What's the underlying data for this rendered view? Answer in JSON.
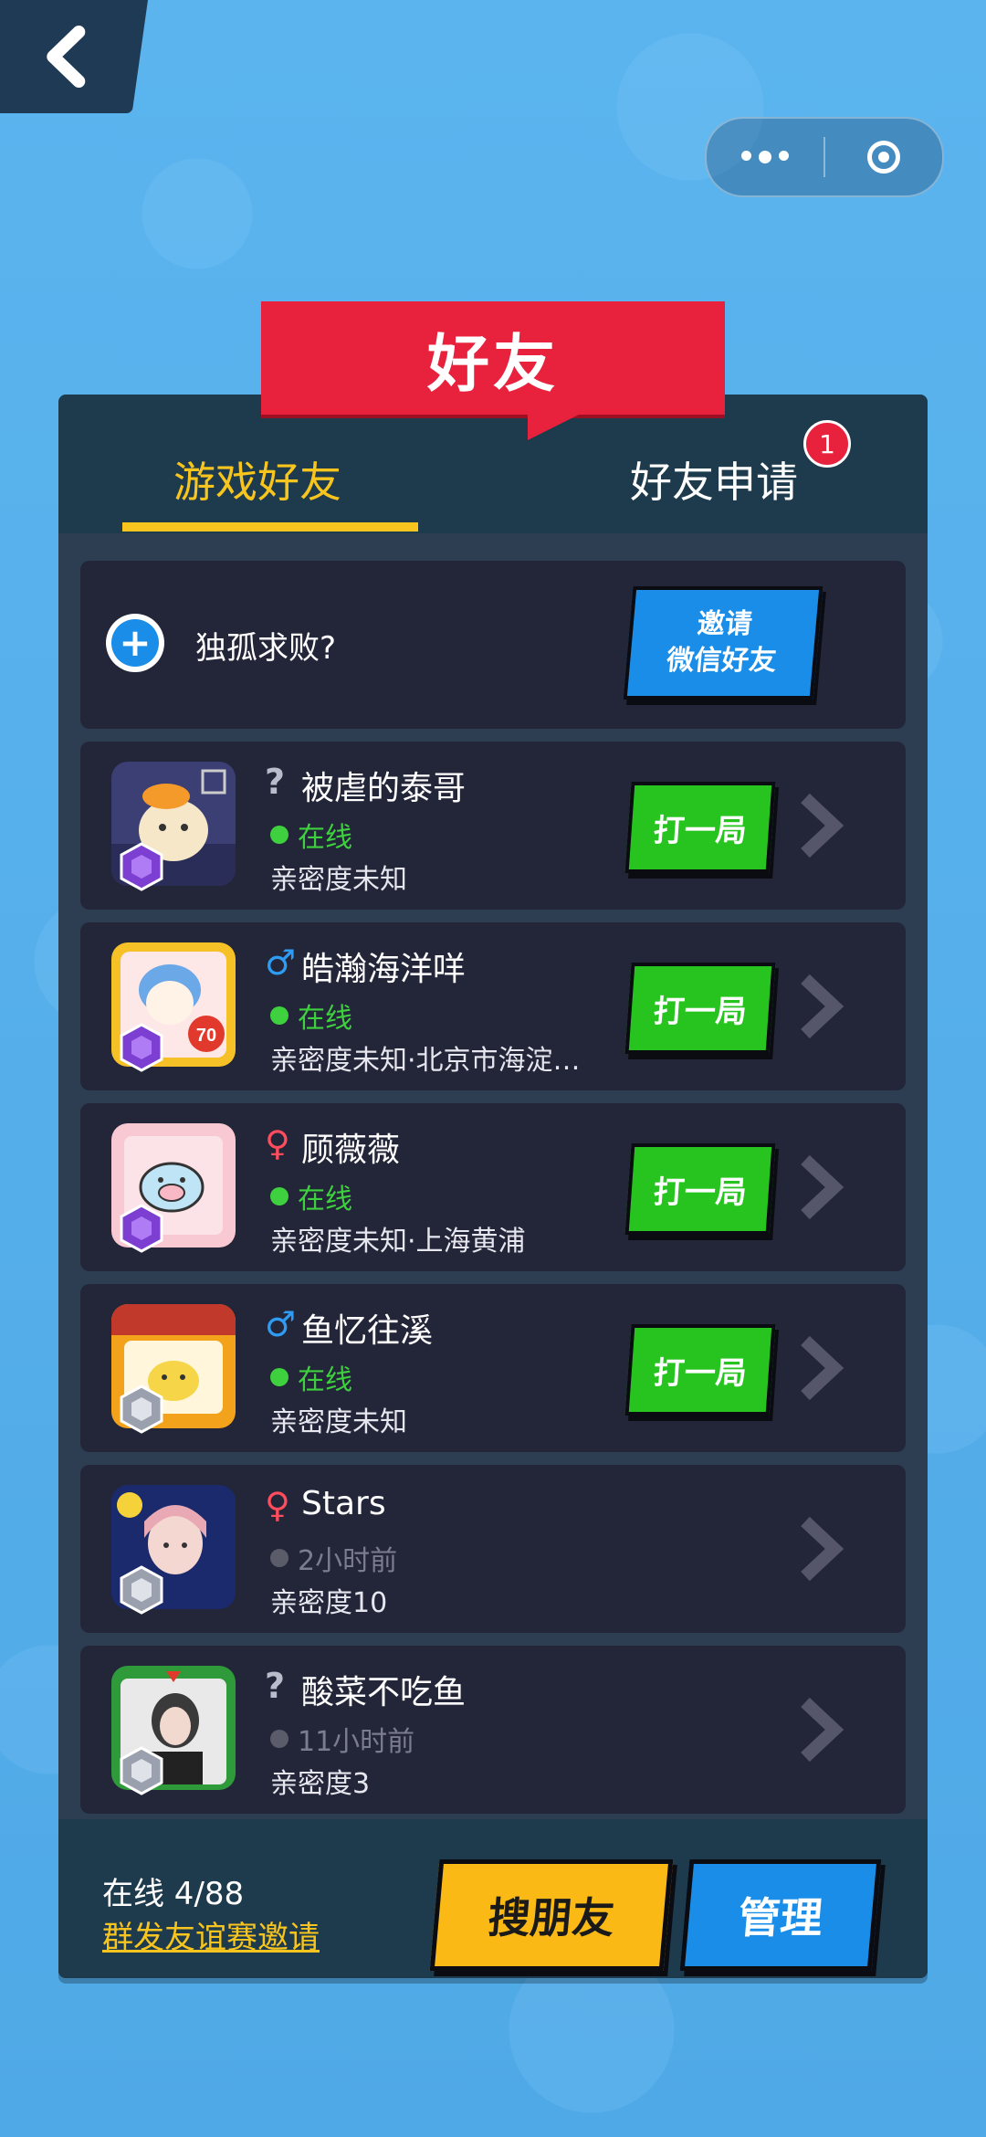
{
  "header": {
    "title": "好友"
  },
  "tabs": [
    {
      "label": "游戏好友",
      "active": true
    },
    {
      "label": "好友申请",
      "active": false,
      "badge": "1"
    }
  ],
  "invite": {
    "plus_icon": "+",
    "text": "独孤求败?",
    "button_line1": "邀请",
    "button_line2": "微信好友"
  },
  "friends": [
    {
      "gender": "?",
      "gender_color": "#b8bccb",
      "name": "被虐的泰哥",
      "status": "在线",
      "online": true,
      "detail": "亲密度未知",
      "action": "打一局"
    },
    {
      "gender": "♂",
      "gender_color": "#2f9cf3",
      "name": "皓瀚海洋咩",
      "status": "在线",
      "online": true,
      "detail": "亲密度未知·北京市海淀…",
      "action": "打一局"
    },
    {
      "gender": "♀",
      "gender_color": "#ff4d5e",
      "name": "顾薇薇",
      "status": "在线",
      "online": true,
      "detail": "亲密度未知·上海黄浦",
      "action": "打一局"
    },
    {
      "gender": "♂",
      "gender_color": "#2f9cf3",
      "name": "鱼忆往溪",
      "status": "在线",
      "online": true,
      "detail": "亲密度未知",
      "action": "打一局"
    },
    {
      "gender": "♀",
      "gender_color": "#ff4d5e",
      "name": "Stars",
      "status": "2小时前",
      "online": false,
      "detail": "亲密度10",
      "action": ""
    },
    {
      "gender": "?",
      "gender_color": "#b8bccb",
      "name": "酸菜不吃鱼",
      "status": "11小时前",
      "online": false,
      "detail": "亲密度3",
      "action": ""
    }
  ],
  "footer": {
    "online_count": "在线 4/88",
    "group_invite": "群发友谊赛邀请",
    "search_button": "搜朋友",
    "manage_button": "管理"
  },
  "colors": {
    "accent_yellow": "#f7c51e",
    "banner_red": "#e8223d",
    "play_green": "#27c41f",
    "blue": "#1a8de8",
    "panel": "#1e3a4d",
    "card": "#232538"
  }
}
